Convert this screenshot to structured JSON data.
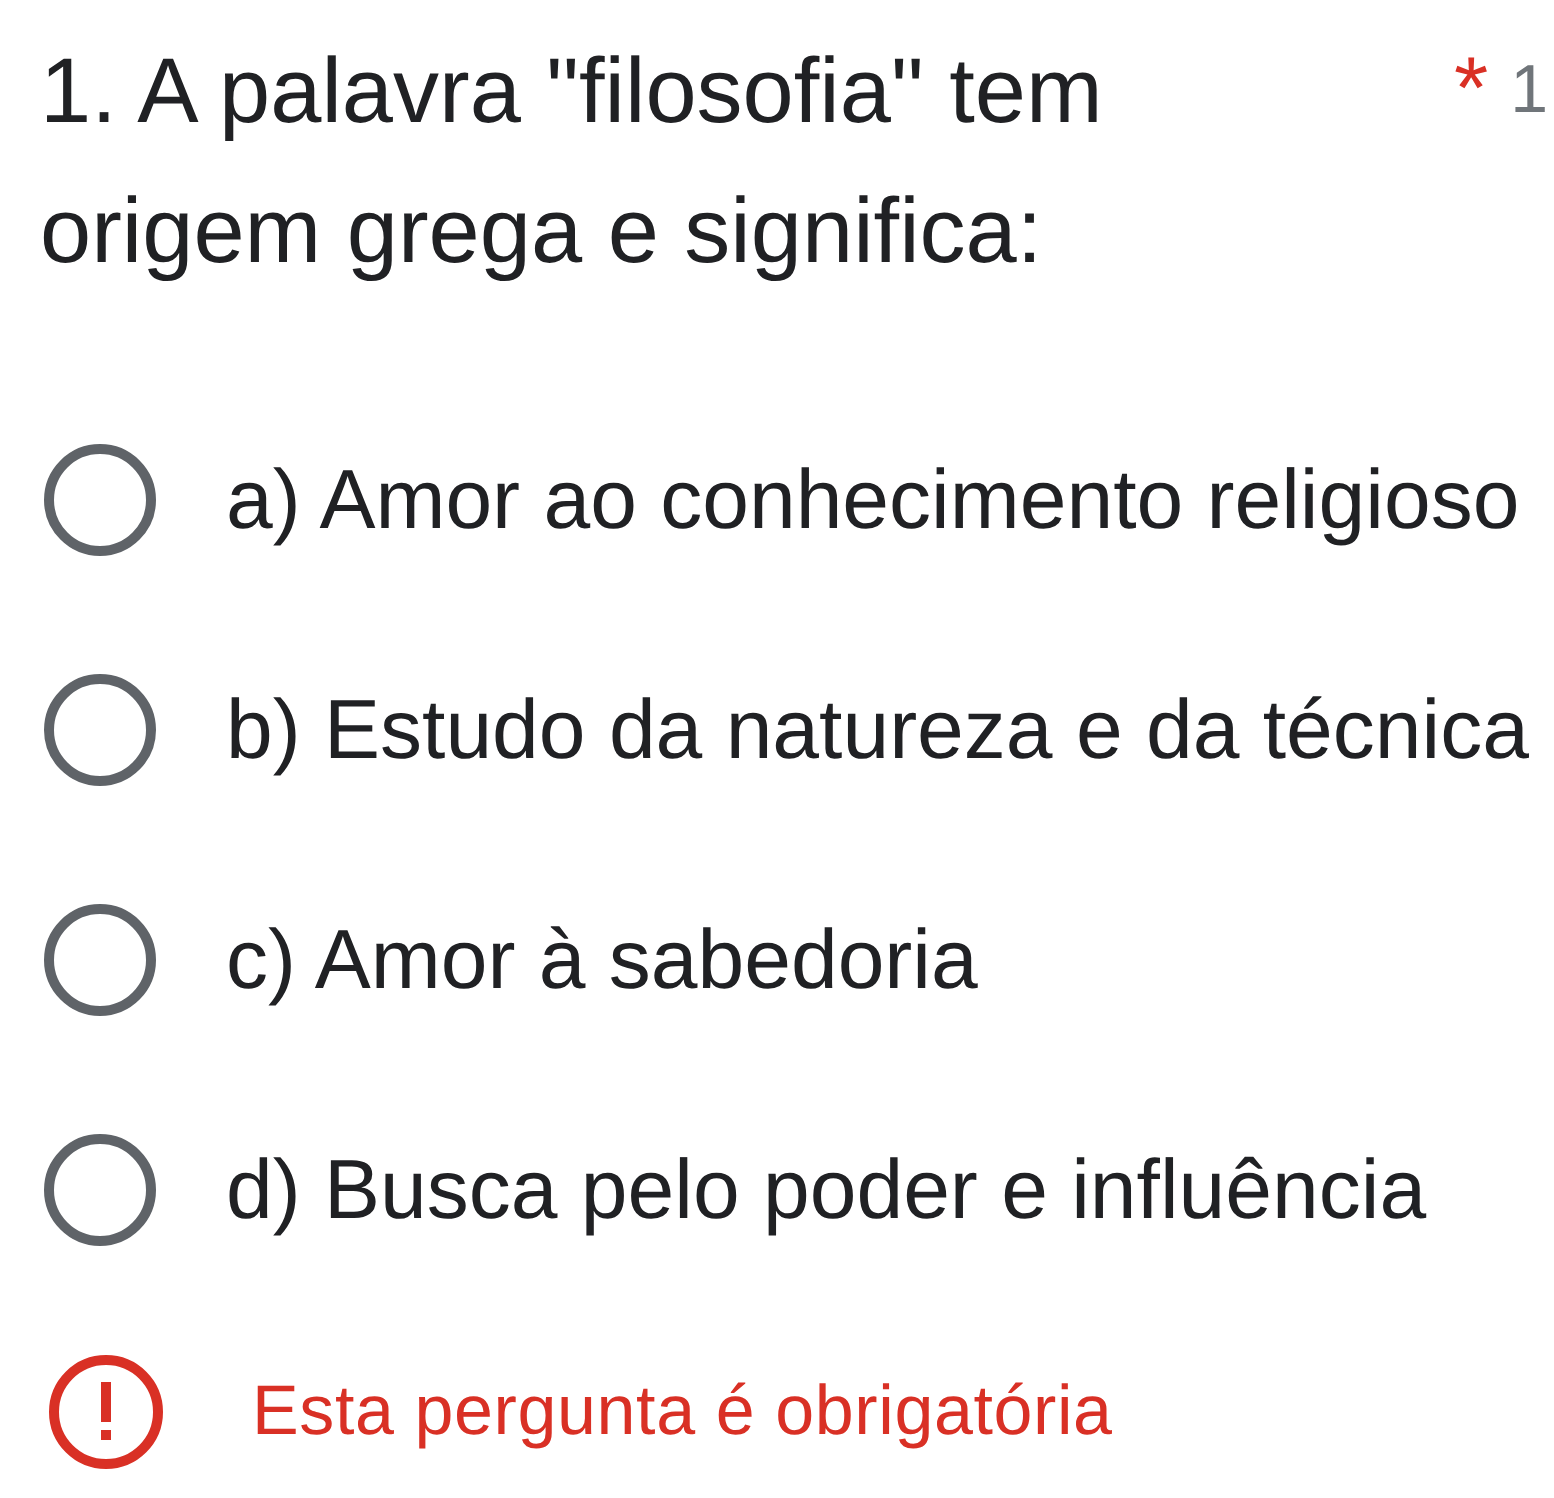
{
  "question": {
    "title": "1. A palavra \"filosofia\" tem origem grega e significa:",
    "required_mark": "*",
    "points": "1"
  },
  "options": [
    {
      "label": "a) Amor ao conhecimento religioso",
      "selected": false
    },
    {
      "label": "b) Estudo da natureza e da técnica",
      "selected": false
    },
    {
      "label": "c) Amor à sabedoria",
      "selected": false
    },
    {
      "label": "d) Busca pelo poder e influência",
      "selected": false
    }
  ],
  "error": {
    "message": "Esta pergunta é obrigatória"
  }
}
